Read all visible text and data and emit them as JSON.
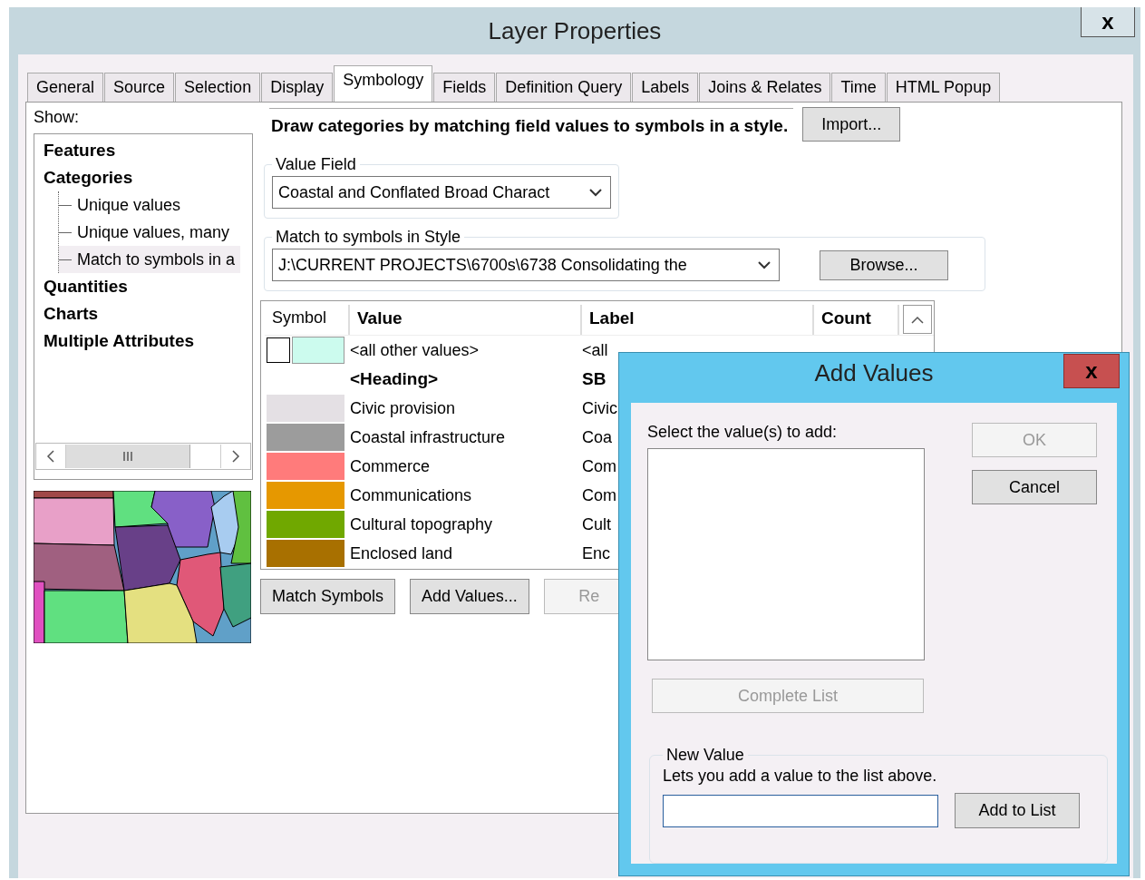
{
  "window": {
    "title": "Layer Properties",
    "close": "x"
  },
  "tabs": [
    {
      "label": "General",
      "selected": false
    },
    {
      "label": "Source",
      "selected": false
    },
    {
      "label": "Selection",
      "selected": false
    },
    {
      "label": "Display",
      "selected": false
    },
    {
      "label": "Symbology",
      "selected": true
    },
    {
      "label": "Fields",
      "selected": false
    },
    {
      "label": "Definition Query",
      "selected": false
    },
    {
      "label": "Labels",
      "selected": false
    },
    {
      "label": "Joins & Relates",
      "selected": false
    },
    {
      "label": "Time",
      "selected": false
    },
    {
      "label": "HTML Popup",
      "selected": false
    }
  ],
  "show_label": "Show:",
  "tree": [
    {
      "label": "Features",
      "selected": false
    },
    {
      "label": "Categories",
      "selected": false,
      "children": [
        {
          "label": "Unique values",
          "selected": false
        },
        {
          "label": "Unique values, many",
          "selected": false
        },
        {
          "label": "Match to symbols in a",
          "selected": true
        }
      ]
    },
    {
      "label": "Quantities",
      "selected": false
    },
    {
      "label": "Charts",
      "selected": false
    },
    {
      "label": "Multiple Attributes",
      "selected": false
    }
  ],
  "description": "Draw categories by matching field values to symbols in a style.",
  "import_button": "Import...",
  "value_field": {
    "legend": "Value Field",
    "value": "Coastal and Conflated Broad Charact"
  },
  "style_group": {
    "legend": "Match to symbols in Style",
    "value": "J:\\CURRENT PROJECTS\\6700s\\6738 Consolidating the",
    "browse": "Browse..."
  },
  "table": {
    "columns": [
      "Symbol",
      "Value",
      "Label",
      "Count"
    ],
    "rows": [
      {
        "kind": "other",
        "color": "#ccfbee",
        "value": "<all other values>",
        "label": "<all"
      },
      {
        "kind": "heading",
        "value": "<Heading>",
        "label": "SB"
      },
      {
        "kind": "class",
        "color": "#e4e0e4",
        "value": "Civic provision",
        "label": "Civic"
      },
      {
        "kind": "class",
        "color": "#9c9c9c",
        "value": "Coastal infrastructure",
        "label": "Coa"
      },
      {
        "kind": "class",
        "color": "#ff7b7b",
        "value": "Commerce",
        "label": "Com"
      },
      {
        "kind": "class",
        "color": "#e69800",
        "value": "Communications",
        "label": "Com"
      },
      {
        "kind": "class",
        "color": "#70a800",
        "value": "Cultural topography",
        "label": "Cult"
      },
      {
        "kind": "class",
        "color": "#a87000",
        "value": "Enclosed land",
        "label": "Enc"
      }
    ]
  },
  "buttons": [
    {
      "label": "Match Symbols",
      "disabled": false
    },
    {
      "label": "Add Values...",
      "disabled": false
    },
    {
      "label": "Re",
      "disabled": true
    }
  ],
  "dialog": {
    "title": "Add Values",
    "close": "x",
    "prompt": "Select the value(s) to add:",
    "ok": {
      "label": "OK",
      "disabled": true
    },
    "cancel": {
      "label": "Cancel",
      "disabled": false
    },
    "complete": {
      "label": "Complete List",
      "disabled": true
    },
    "new_value": {
      "legend": "New Value",
      "hint": "Lets you add a value to the list above.",
      "button": "Add to List"
    }
  }
}
